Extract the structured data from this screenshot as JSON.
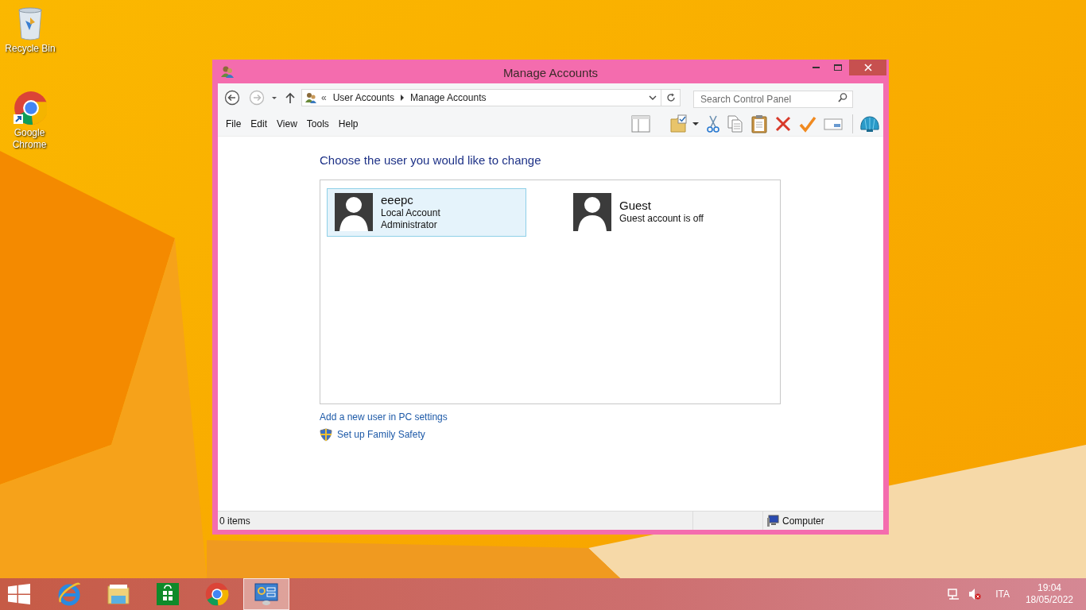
{
  "desktop_icons": [
    {
      "kind": "recycle-bin",
      "label": "Recycle Bin"
    },
    {
      "kind": "chrome",
      "label": "Google Chrome"
    }
  ],
  "window": {
    "title": "Manage Accounts",
    "address": {
      "overflow": "«",
      "crumbs": [
        "User Accounts",
        "Manage Accounts"
      ]
    },
    "search": {
      "placeholder": "Search Control Panel"
    },
    "menu": [
      "File",
      "Edit",
      "View",
      "Tools",
      "Help"
    ],
    "heading": "Choose the user you would like to change",
    "accounts": [
      {
        "name": "eeepc",
        "details": [
          "Local Account",
          "Administrator"
        ],
        "selected": true
      },
      {
        "name": "Guest",
        "details": [
          "Guest account is off"
        ],
        "selected": false
      }
    ],
    "links": [
      {
        "label": "Add a new user in PC settings",
        "shield": false
      },
      {
        "label": "Set up Family Safety",
        "shield": true
      }
    ],
    "status_bar": {
      "count": "0 items",
      "zone": "Computer"
    }
  },
  "taskbar": {
    "apps": [
      {
        "kind": "ie",
        "selected": false
      },
      {
        "kind": "explorer",
        "selected": false
      },
      {
        "kind": "store",
        "selected": false
      },
      {
        "kind": "chrome",
        "selected": false
      },
      {
        "kind": "control-panel",
        "selected": true
      }
    ],
    "language": "ITA",
    "time": "19:04",
    "date": "18/05/2022"
  }
}
